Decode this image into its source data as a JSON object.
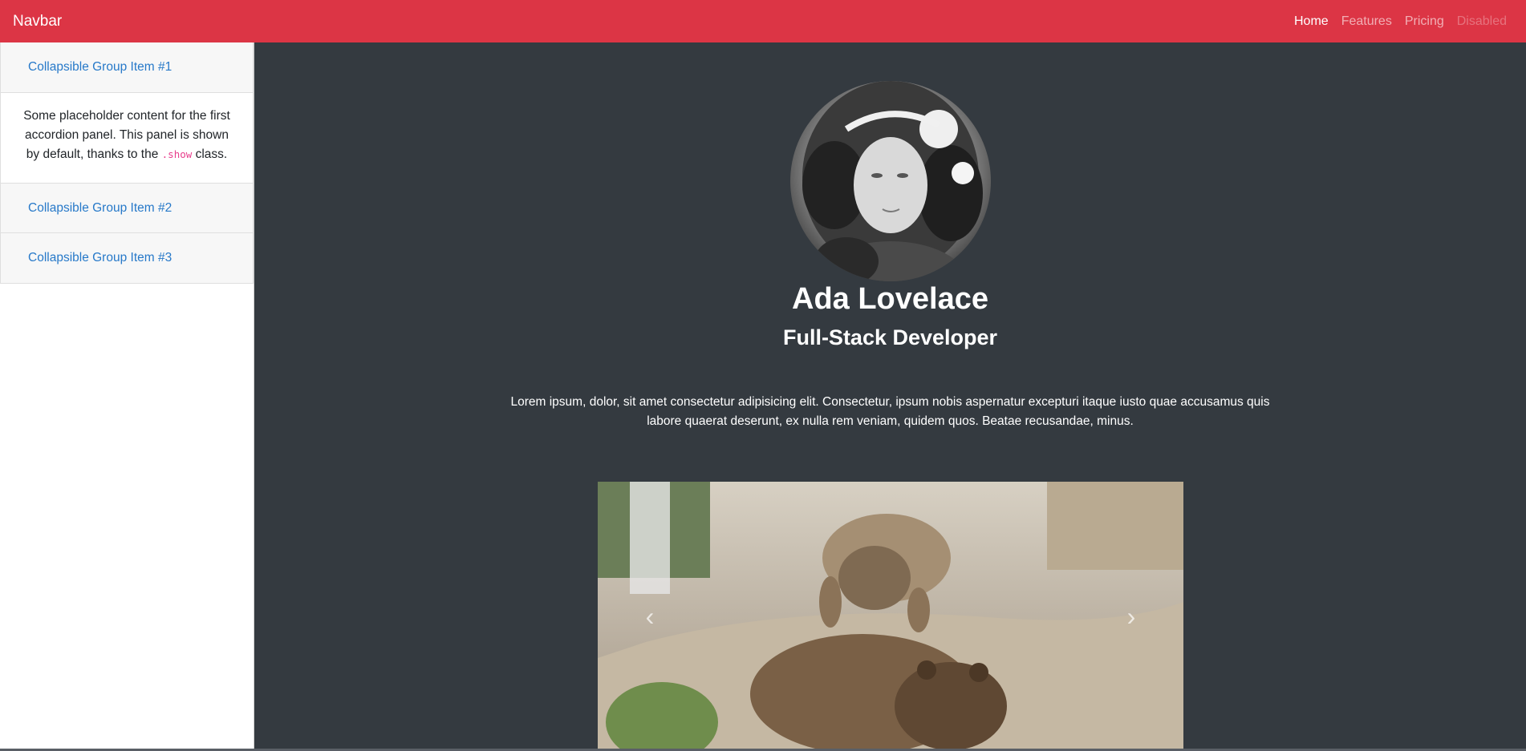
{
  "navbar": {
    "brand": "Navbar",
    "links": [
      {
        "label": "Home",
        "state": "active"
      },
      {
        "label": "Features",
        "state": "normal"
      },
      {
        "label": "Pricing",
        "state": "normal"
      },
      {
        "label": "Disabled",
        "state": "disabled"
      }
    ],
    "color": "#dc3545"
  },
  "sidebar": {
    "accordion": [
      {
        "title": "Collapsible Group Item #1",
        "expanded": true,
        "body_before": "Some placeholder content for the first accordion panel. This panel is shown by default, thanks to the ",
        "body_code": ".show",
        "body_after": " class."
      },
      {
        "title": "Collapsible Group Item #2",
        "expanded": false
      },
      {
        "title": "Collapsible Group Item #3",
        "expanded": false
      }
    ]
  },
  "main": {
    "avatar_icon": "portrait-photo",
    "name": "Ada Lovelace",
    "role": "Full-Stack Developer",
    "bio": "Lorem ipsum, dolor, sit amet consectetur adipisicing elit. Consectetur, ipsum nobis aspernatur excepturi itaque iusto quae accusamus quis labore quaerat deserunt, ex nulla rem veniam, quidem quos. Beatae recusandae, minus.",
    "carousel": {
      "image_icon": "bears-photo",
      "prev_glyph": "‹",
      "next_glyph": "›"
    },
    "background": "#343a40"
  }
}
